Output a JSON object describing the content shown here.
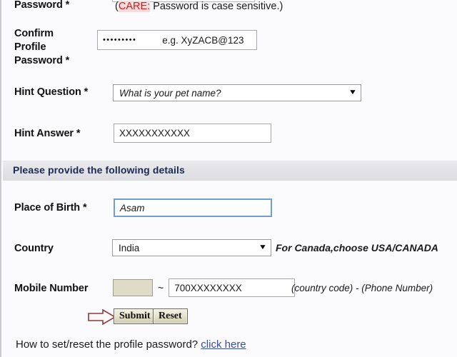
{
  "form": {
    "password_label": "Password *",
    "care_note": {
      "open_paren": "(",
      "care_word": "CARE:",
      "rest": " Password is case sensitive.)"
    },
    "confirm_password": {
      "label": "Confirm\nProfile\nPassword *",
      "value_dots": "•••••••••",
      "example_hint": "e.g. XyZACB@123"
    },
    "hint_question": {
      "label": "Hint Question *",
      "selected": "What is your pet name?",
      "caret_icon": "▼"
    },
    "hint_answer": {
      "label": "Hint Answer *",
      "value": "XXXXXXXXXXX"
    },
    "section_header": "Please provide the following details",
    "place_of_birth": {
      "label": "Place of Birth *",
      "value": "Asam"
    },
    "country": {
      "label": "Country",
      "selected": "India",
      "caret_icon": "▼",
      "note": "For Canada,choose USA/CANADA"
    },
    "mobile_number": {
      "label": "Mobile Number",
      "country_code_value": "",
      "separator": "~",
      "phone_value": "700XXXXXXXX",
      "note": "(country code) - (Phone Number)"
    },
    "actions": {
      "arrow_icon": "right-arrow-icon",
      "submit_label": "Submit",
      "reset_label": "Reset"
    },
    "footer": {
      "text": "How to set/reset the profile password? ",
      "link_label": "click here"
    }
  },
  "colors": {
    "care_red": "#d01c1c",
    "care_highlight": "#f6dcdc",
    "section_text": "#1b2a52",
    "link": "#3b4fa0",
    "focus_border": "#6f9fd0",
    "country_code_fill": "#dedbc7",
    "arrow_outline": "#8e3b3b"
  }
}
